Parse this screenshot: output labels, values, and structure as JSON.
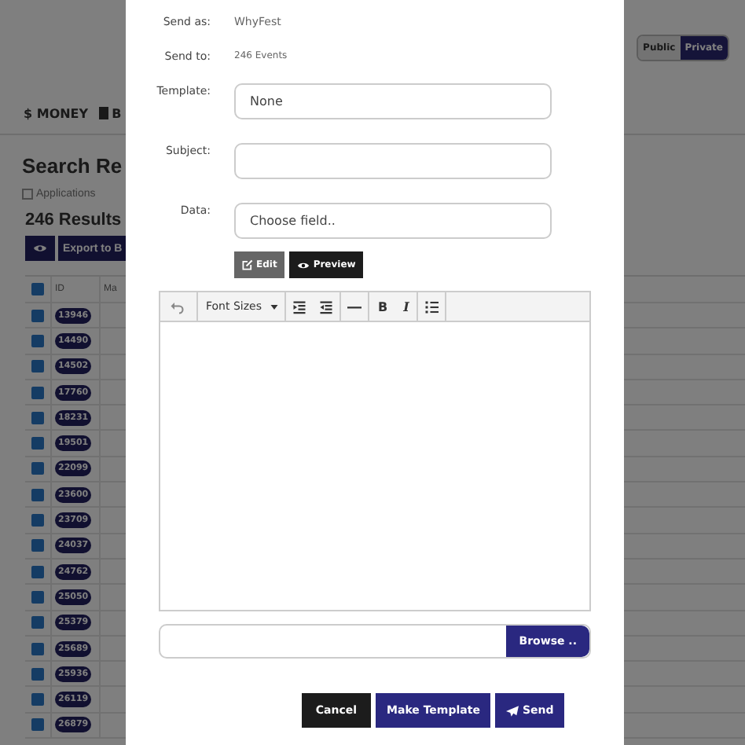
{
  "background": {
    "visibility": [
      {
        "label": "Public",
        "selected": false
      },
      {
        "label": "Private",
        "selected": true
      }
    ],
    "nav": [
      {
        "label": "$ MONEY",
        "book_icon": false
      },
      {
        "label": "B",
        "book_icon": true
      }
    ],
    "title": "Search Re",
    "filter": {
      "label": "Applications",
      "checked": false
    },
    "results": "246 Results",
    "export_button": "Export to B",
    "table": {
      "header_checked": true,
      "columns": [
        "ID",
        "Ma"
      ],
      "rows": [
        {
          "id": "13946",
          "checked": true
        },
        {
          "id": "14490",
          "checked": true
        },
        {
          "id": "14502",
          "checked": true
        },
        {
          "id": "17760",
          "checked": true
        },
        {
          "id": "18231",
          "checked": true
        },
        {
          "id": "19501",
          "checked": true
        },
        {
          "id": "22099",
          "checked": true
        },
        {
          "id": "23600",
          "checked": true
        },
        {
          "id": "23709",
          "checked": true
        },
        {
          "id": "24037",
          "checked": true
        },
        {
          "id": "24762",
          "checked": true
        },
        {
          "id": "25050",
          "checked": true
        },
        {
          "id": "25379",
          "checked": true
        },
        {
          "id": "25689",
          "checked": true
        },
        {
          "id": "25936",
          "checked": true
        },
        {
          "id": "26119",
          "checked": true
        },
        {
          "id": "26879",
          "checked": true
        }
      ]
    }
  },
  "modal": {
    "info": [
      {
        "label": "Send as:",
        "value": "WhyFest"
      },
      {
        "label": "Send to:",
        "value": "246 Events"
      }
    ],
    "fields": [
      {
        "label": "Template:",
        "value": "None"
      },
      {
        "label": "Subject:"
      },
      {
        "label": "Data:",
        "value": "Choose field.."
      }
    ],
    "mode_tabs": [
      {
        "label": "Edit",
        "selected": false
      },
      {
        "label": "Preview",
        "selected": true
      }
    ],
    "toolbar": [
      {
        "items": [
          {
            "kind": "undo"
          }
        ]
      },
      {
        "items": [
          {
            "kind": "dropdown",
            "label": "Font Sizes"
          }
        ]
      },
      {
        "items": [
          {
            "kind": "indent"
          },
          {
            "kind": "outdent"
          }
        ]
      },
      {
        "items": [
          {
            "kind": "rule"
          }
        ]
      },
      {
        "items": [
          {
            "kind": "bold",
            "label": "B"
          },
          {
            "kind": "italic",
            "label": "I"
          }
        ]
      },
      {
        "items": [
          {
            "kind": "list"
          }
        ]
      }
    ],
    "browse_button": "Browse ..",
    "actions": [
      {
        "label": "Cancel",
        "kind": "dark",
        "icon": false
      },
      {
        "label": "Make Template",
        "kind": "primary",
        "icon": false
      },
      {
        "label": "Send",
        "kind": "primary",
        "icon": true
      }
    ]
  }
}
